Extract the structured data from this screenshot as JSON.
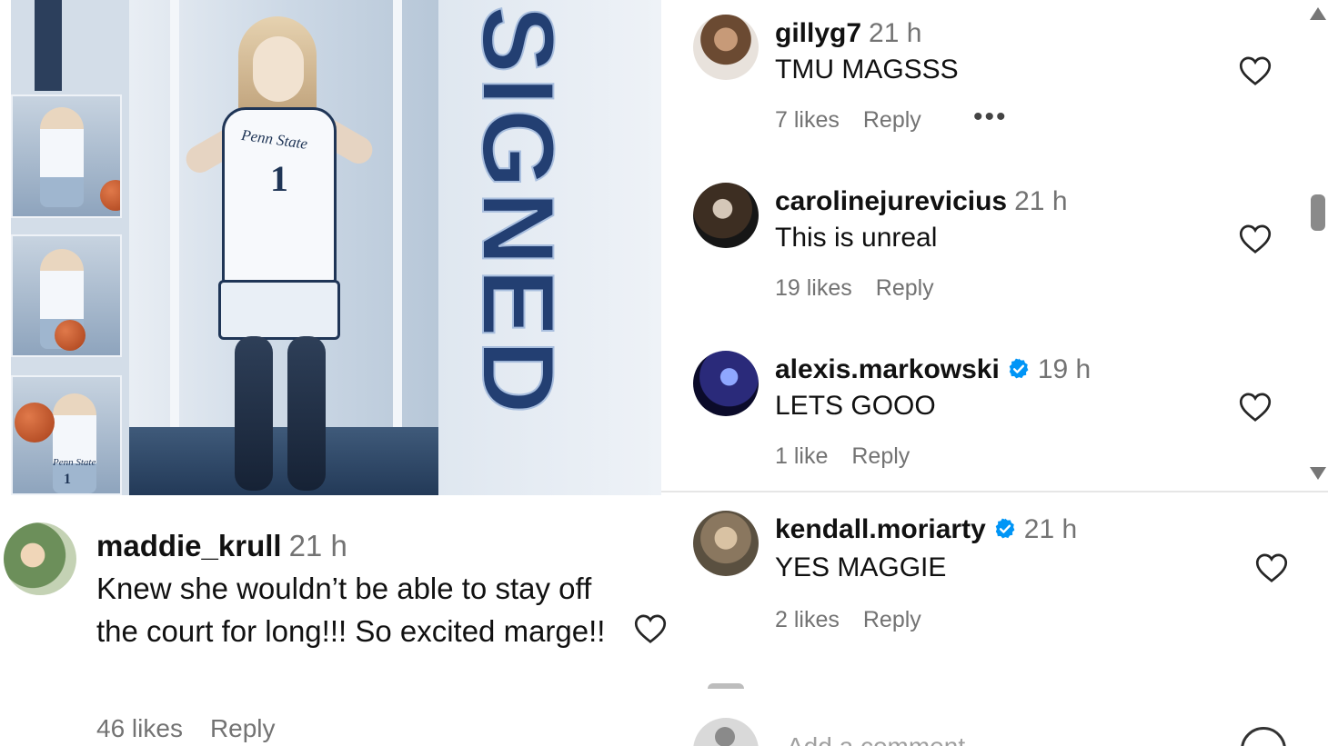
{
  "post_image": {
    "overlay_text": "SIGNED",
    "jersey_team": "Penn State",
    "jersey_number": "1",
    "thumbnail_jersey_team": "Penn State",
    "thumbnail_jersey_number": "1"
  },
  "left_comment": {
    "username": "maddie_krull",
    "time": "21 h",
    "text": "Knew she wouldn’t be able to stay off the court for long!!! So excited marge!!",
    "likes": "46 likes",
    "reply": "Reply",
    "icons": {
      "like": "heart-outline-icon"
    }
  },
  "comments": [
    {
      "username": "gillyg7",
      "time": "21 h",
      "verified": false,
      "text": "TMU MAGSSS",
      "likes": "7 likes",
      "reply": "Reply",
      "more": "•••"
    },
    {
      "username": "carolinejurevicius",
      "time": "21 h",
      "verified": false,
      "text": "This is unreal",
      "likes": "19 likes",
      "reply": "Reply"
    },
    {
      "username": "alexis.markowski",
      "time": "19 h",
      "verified": true,
      "text": "LETS GOOO",
      "likes": "1 like",
      "reply": "Reply"
    },
    {
      "username": "kendall.moriarty",
      "time": "21 h",
      "verified": true,
      "text": "YES MAGGIE",
      "likes": "2 likes",
      "reply": "Reply"
    }
  ],
  "add_comment_placeholder": "Add a comment...",
  "colors": {
    "text": "#111111",
    "muted": "#737373",
    "verified": "#0095f6",
    "signed_text": "#233f72"
  }
}
